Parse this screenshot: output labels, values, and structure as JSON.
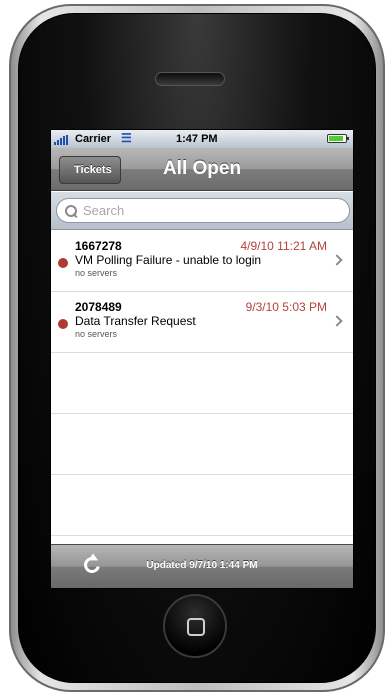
{
  "status_bar": {
    "carrier": "Carrier",
    "time": "1:47 PM",
    "battery_level": 0.9
  },
  "nav": {
    "back_label": "Tickets",
    "title": "All Open"
  },
  "search": {
    "placeholder": "Search"
  },
  "tickets": [
    {
      "id": "1667278",
      "date": "4/9/10 11:21 AM",
      "title": "VM Polling Failure - unable to login",
      "subtitle": "no servers"
    },
    {
      "id": "2078489",
      "date": "9/3/10 5:03 PM",
      "title": "Data Transfer Request",
      "subtitle": "no servers"
    }
  ],
  "toolbar": {
    "updated": "Updated 9/7/10 1:44 PM"
  },
  "colors": {
    "status_dot": "#b03a33",
    "date_text": "#b5423b"
  }
}
